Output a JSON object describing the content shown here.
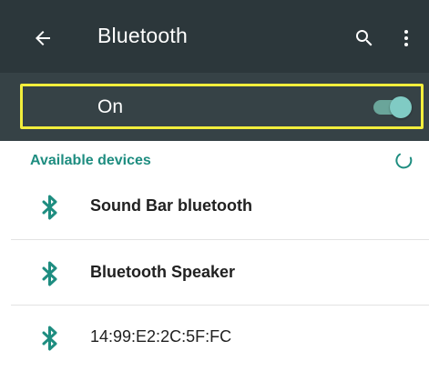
{
  "appbar": {
    "title": "Bluetooth",
    "back_icon": "arrow-back-icon",
    "search_icon": "search-icon",
    "more_icon": "more-vert-icon",
    "background": "#2c373b"
  },
  "switch": {
    "label": "On",
    "state": true,
    "accent": "#80cbc4",
    "highlight_color": "#f2ee3c"
  },
  "section": {
    "title": "Available devices",
    "spinner_icon": "progress-spinner-icon",
    "color": "#1e8d80"
  },
  "devices": [
    {
      "name": "Sound Bar bluetooth",
      "icon": "bluetooth-icon",
      "bold": true
    },
    {
      "name": "Bluetooth Speaker",
      "icon": "bluetooth-icon",
      "bold": true
    },
    {
      "name": "14:99:E2:2C:5F:FC",
      "icon": "bluetooth-icon",
      "bold": false
    }
  ]
}
